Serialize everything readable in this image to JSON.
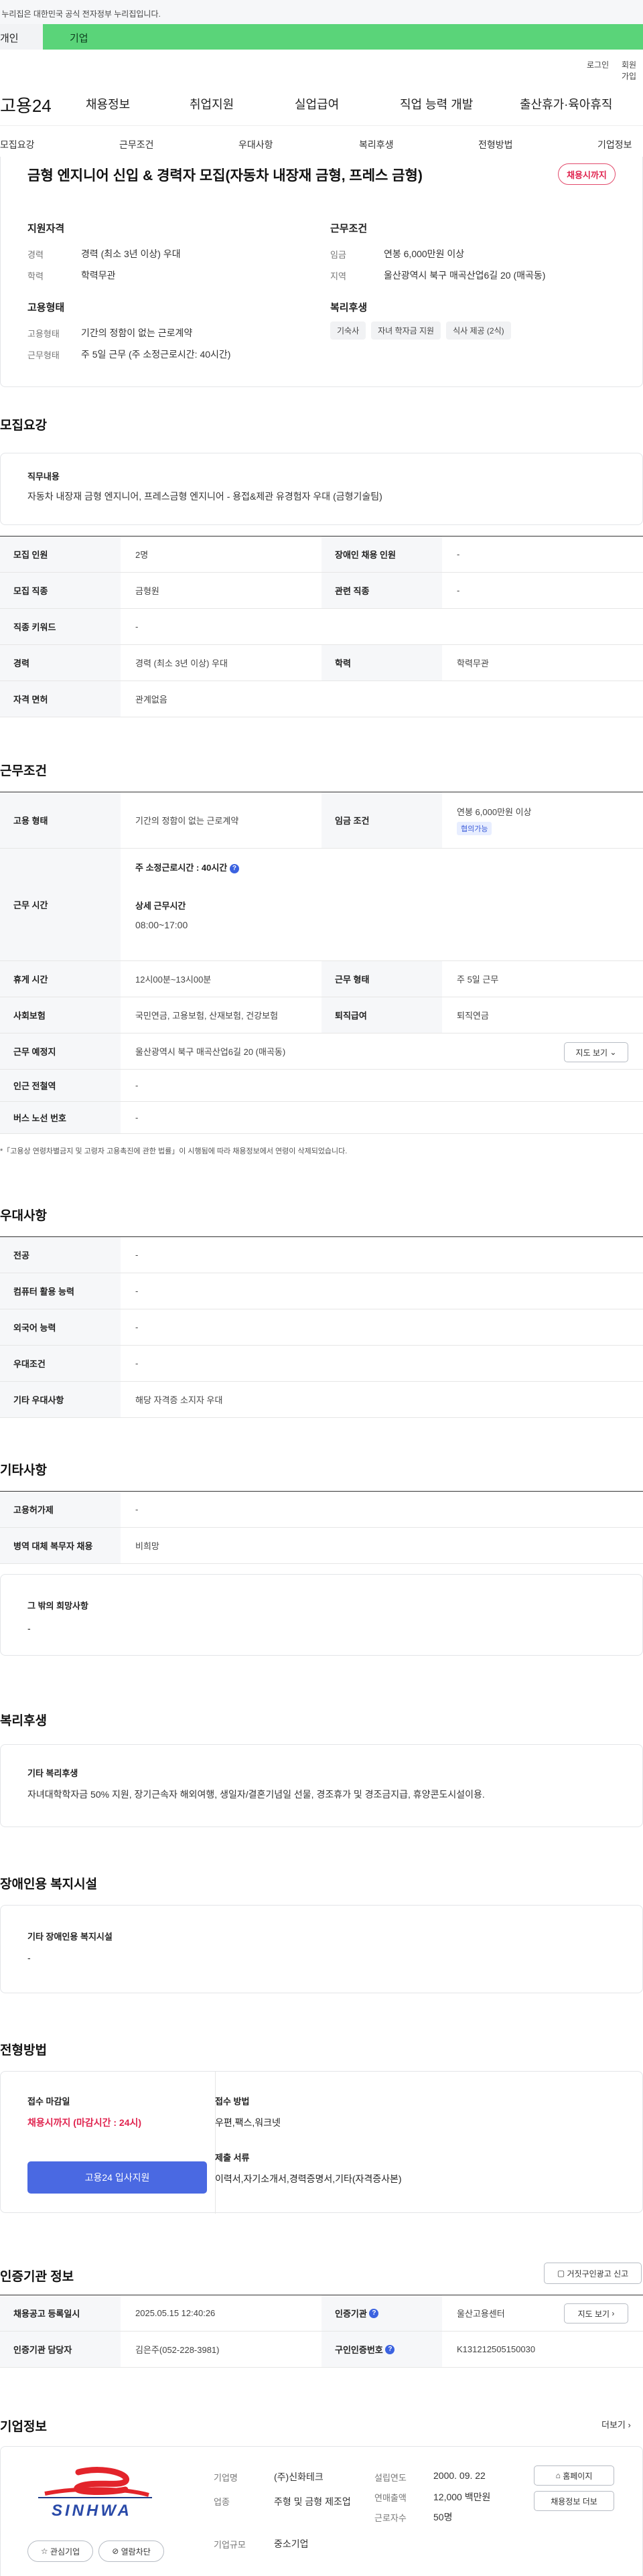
{
  "gov_banner": "이 누리집은 대한민국 공식 전자정부 누리집입니다.",
  "top_tabs": [
    "개인",
    "기업"
  ],
  "util_links": [
    "로그인",
    "회원가입"
  ],
  "logo": "고용24",
  "gnb": [
    "채용정보",
    "취업지원",
    "실업급여",
    "직업 능력 개발",
    "출산휴가·육아휴직"
  ],
  "subnav": [
    "모집요강",
    "근무조건",
    "우대사항",
    "복리후생",
    "전형방법",
    "기업정보"
  ],
  "job": {
    "title": "금형 엔지니어 신입 & 경력자 모집(자동차 내장재 금형, 프레스 금형)",
    "status": "채용시까지",
    "qual_head": "지원자격",
    "qual": [
      {
        "k": "경력",
        "v": "경력 (최소 3년 이상) 우대"
      },
      {
        "k": "학력",
        "v": "학력무관"
      }
    ],
    "cond_head": "근무조건",
    "cond": [
      {
        "k": "임금",
        "v": "연봉 6,000만원 이상"
      },
      {
        "k": "지역",
        "v": "울산광역시 북구 매곡산업6길 20 (매곡동)"
      }
    ],
    "emp_head": "고용형태",
    "emp": [
      {
        "k": "고용형태",
        "v": "기간의 정함이 없는 근로계약"
      },
      {
        "k": "근무형태",
        "v": "주 5일 근무 (주 소정근로시간: 40시간)"
      }
    ],
    "welfare_head": "복리후생",
    "welfare_chips": [
      "기숙사",
      "자녀 학자금 지원",
      "식사 제공 (2식)"
    ]
  },
  "recruit": {
    "title": "모집요강",
    "duty_head": "직무내용",
    "duty": "자동차 내장재 금형 엔지니어, 프레스금형  엔지니어 - 용접&제관 유경험자 우대 (금형기술팀)",
    "rows": [
      {
        "th1": "모집 인원",
        "td1": "2명",
        "th2": "장애인 채용 인원",
        "td2": "-"
      },
      {
        "th1": "모집 직종",
        "td1": "금형원",
        "th2": "관련 직종",
        "td2": "-"
      },
      {
        "th1": "직종 키워드",
        "td1": "-"
      },
      {
        "th1": "경력",
        "td1": "경력 (최소 3년 이상) 우대",
        "th2": "학력",
        "td2": "학력무관"
      },
      {
        "th1": "자격 면허",
        "td1": "관계없음"
      }
    ]
  },
  "work": {
    "title": "근무조건",
    "emp_type_th": "고용 형태",
    "emp_type": "기간의 정함이 없는 근로계약",
    "wage_th": "임금 조건",
    "wage": "연봉 6,000만원 이상",
    "wage_badge": "협의가능",
    "hours_th": "근무 시간",
    "hours_main": "주 소정근로시간 : 40시간",
    "hours_detail_head": "상세 근무시간",
    "hours_detail": "08:00~17:00",
    "rest_th": "휴게 시간",
    "rest": "12시00분~13시00분",
    "shift_th": "근무 형태",
    "shift": "주 5일 근무",
    "ins_th": "사회보험",
    "ins": "국민연금, 고용보험, 산재보험, 건강보험",
    "retire_th": "퇴직급여",
    "retire": "퇴직연금",
    "place_th": "근무 예정지",
    "place": "울산광역시 북구 매곡산업6길 20 (매곡동)",
    "map_btn": "지도 보기",
    "subway_th": "인근 전철역",
    "subway": "-",
    "bus_th": "버스 노선 번호",
    "bus": "-",
    "note": "*「고용상 연령차별금지 및 고령자 고용촉진에 관한 법률」이 시행됨에 따라 채용정보에서 연령이 삭제되었습니다."
  },
  "pref": {
    "title": "우대사항",
    "rows": [
      {
        "th": "전공",
        "td": "-"
      },
      {
        "th": "컴퓨터 활용 능력",
        "td": "-"
      },
      {
        "th": "외국어 능력",
        "td": "-"
      },
      {
        "th": "우대조건",
        "td": "-"
      },
      {
        "th": "기타 우대사항",
        "td": "해당 자격증 소지자 우대"
      }
    ]
  },
  "etc": {
    "title": "기타사항",
    "rows": [
      {
        "th": "고용허가제",
        "td": "-"
      },
      {
        "th": "병역 대체 복무자 채용",
        "td": "비희망"
      }
    ],
    "box_head": "그 밖의 희망사항",
    "box_val": "-"
  },
  "benefit": {
    "title": "복리후생",
    "head": "기타 복리후생",
    "val": "자녀대학학자금 50% 지원, 장기근속자 해외여행, 생일자/결혼기념일 선물, 경조휴가 및 경조금지급, 휴양콘도시설이용."
  },
  "disability": {
    "title": "장애인용 복지시설",
    "head": "기타 장애인용 복지시설",
    "val": "-"
  },
  "selection": {
    "title": "전형방법",
    "deadline_head": "접수 마감일",
    "deadline": "채용시까지 (마감시간 : 24시)",
    "method_head": "접수 방법",
    "method": "우편,팩스,워크넷",
    "docs_head": "제출 서류",
    "docs": "이력서,자기소개서,경력증명서,기타(자격증사본)",
    "apply_btn": "고용24 입사지원"
  },
  "cert": {
    "title": "인증기관 정보",
    "report_btn": "거짓구인광고 신고",
    "r1": {
      "th1": "채용공고 등록일시",
      "td1": "2025.05.15 12:40:26",
      "th2": "인증기관",
      "td2": "울산고용센터",
      "btn": "지도 보기"
    },
    "r2": {
      "th1": "인증기관 담당자",
      "td1": "김은주(052-228-3981)",
      "th2": "구인인증번호",
      "td2": "K131212505150030"
    }
  },
  "company": {
    "title": "기업정보",
    "more": "더보기",
    "logo_text": "SINHWA",
    "fav_btn": "관심기업",
    "open_btn": "열람차단",
    "name_k": "기업명",
    "name": "(주)신화테크",
    "biz_k": "업종",
    "biz": "주형 및 금형 제조업",
    "size_k": "기업규모",
    "size": "중소기업",
    "est_k": "설립연도",
    "est": "2000. 09. 22",
    "sales_k": "연매출액",
    "sales": "12,000 백만원",
    "emp_k": "근로자수",
    "emp": "50명",
    "home_btn": "홈페이지",
    "recruit_btn": "채용정보 더보"
  },
  "colors": {
    "green": "#5ad479",
    "blue": "#4a69e2",
    "red": "#e0244f"
  }
}
